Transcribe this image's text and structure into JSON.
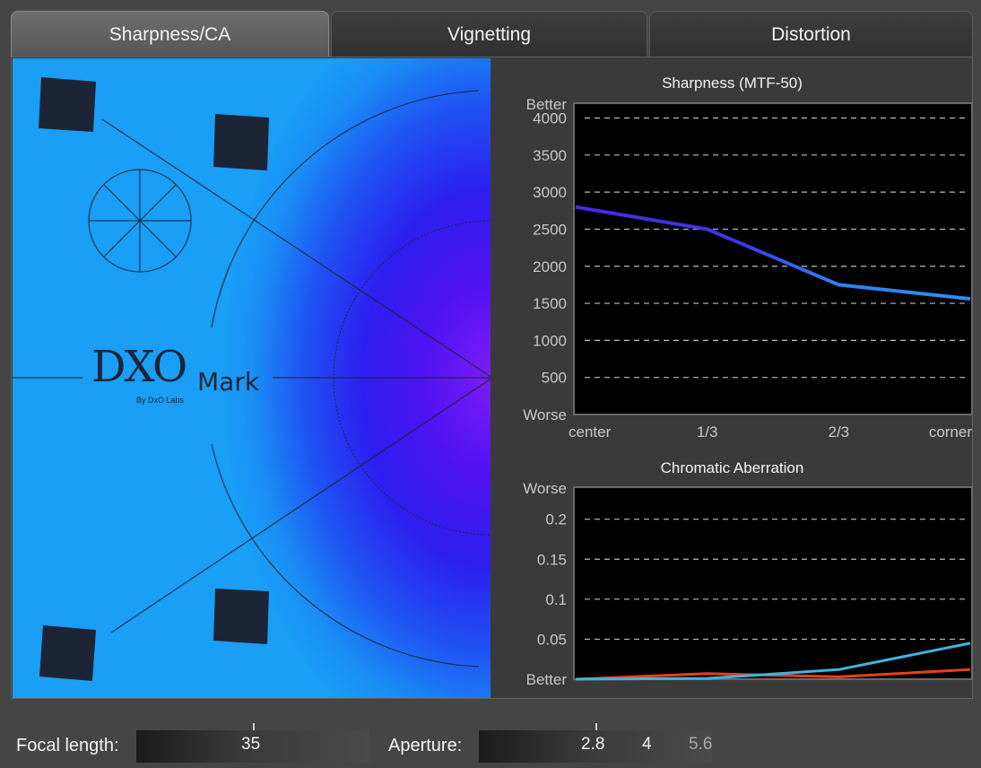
{
  "tabs": [
    {
      "label": "Sharpness/CA",
      "active": true
    },
    {
      "label": "Vignetting",
      "active": false
    },
    {
      "label": "Distortion",
      "active": false
    }
  ],
  "logo": {
    "main": "DXO",
    "mark": "Mark",
    "by": "By DxO Labs"
  },
  "sharpness_chart": {
    "title": "Sharpness (MTF-50)",
    "y_top_label": "Better",
    "y_bottom_label": "Worse",
    "y_ticks": [
      "4000",
      "3500",
      "3000",
      "2500",
      "2000",
      "1500",
      "1000",
      "500"
    ],
    "x_ticks": [
      "center",
      "1/3",
      "2/3",
      "corner"
    ]
  },
  "ca_chart": {
    "title": "Chromatic Aberration",
    "y_top_label": "Worse",
    "y_bottom_label": "Better",
    "y_ticks": [
      "0.2",
      "0.15",
      "0.1",
      "0.05"
    ]
  },
  "chart_data": [
    {
      "type": "line",
      "title": "Sharpness (MTF-50)",
      "x": [
        "center",
        "1/3",
        "2/3",
        "corner"
      ],
      "ylim": [
        0,
        4200
      ],
      "grid": true,
      "series": [
        {
          "color": "#3f2fe0",
          "values": [
            2800,
            2500,
            1750,
            1560
          ]
        }
      ]
    },
    {
      "type": "line",
      "title": "Chromatic Aberration",
      "x": [
        "center",
        "1/3",
        "2/3",
        "corner"
      ],
      "ylim": [
        0,
        0.24
      ],
      "grid": true,
      "series": [
        {
          "color": "#e8401c",
          "values": [
            0.0,
            0.007,
            0.003,
            0.012
          ]
        },
        {
          "color": "#3eb5e0",
          "values": [
            0.0,
            0.001,
            0.012,
            0.045
          ]
        }
      ]
    }
  ],
  "controls": {
    "focal": {
      "label": "Focal length:",
      "value": "35"
    },
    "aperture": {
      "label": "Aperture:",
      "values": [
        "2.8",
        "4",
        "5.6"
      ]
    }
  }
}
